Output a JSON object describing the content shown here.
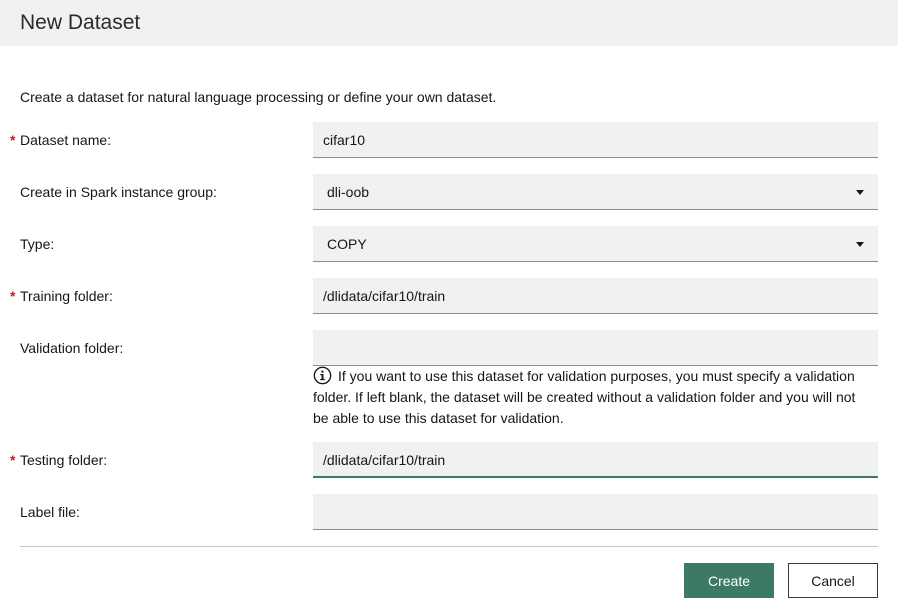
{
  "dialog": {
    "title": "New Dataset",
    "intro": "Create a dataset for natural language processing or define your own dataset."
  },
  "fields": {
    "dataset_name": {
      "label": "Dataset name:",
      "value": "cifar10",
      "required": true
    },
    "spark_group": {
      "label": "Create in Spark instance group:",
      "value": "dli-oob"
    },
    "type": {
      "label": "Type:",
      "value": "COPY"
    },
    "training_folder": {
      "label": "Training folder:",
      "value": "/dlidata/cifar10/train",
      "required": true
    },
    "validation_folder": {
      "label": "Validation folder:",
      "value": "",
      "help": "If you want to use this dataset for validation purposes, you must specify a validation folder. If left blank, the dataset will be created without a validation folder and you will not be able to use this dataset for validation."
    },
    "testing_folder": {
      "label": "Testing folder:",
      "value": "/dlidata/cifar10/train",
      "required": true
    },
    "label_file": {
      "label": "Label file:",
      "value": ""
    }
  },
  "required_marker": "*",
  "buttons": {
    "create": "Create",
    "cancel": "Cancel"
  },
  "colors": {
    "accent": "#3d7a66",
    "required": "#c21e25",
    "field_bg": "#f0f1f2"
  }
}
